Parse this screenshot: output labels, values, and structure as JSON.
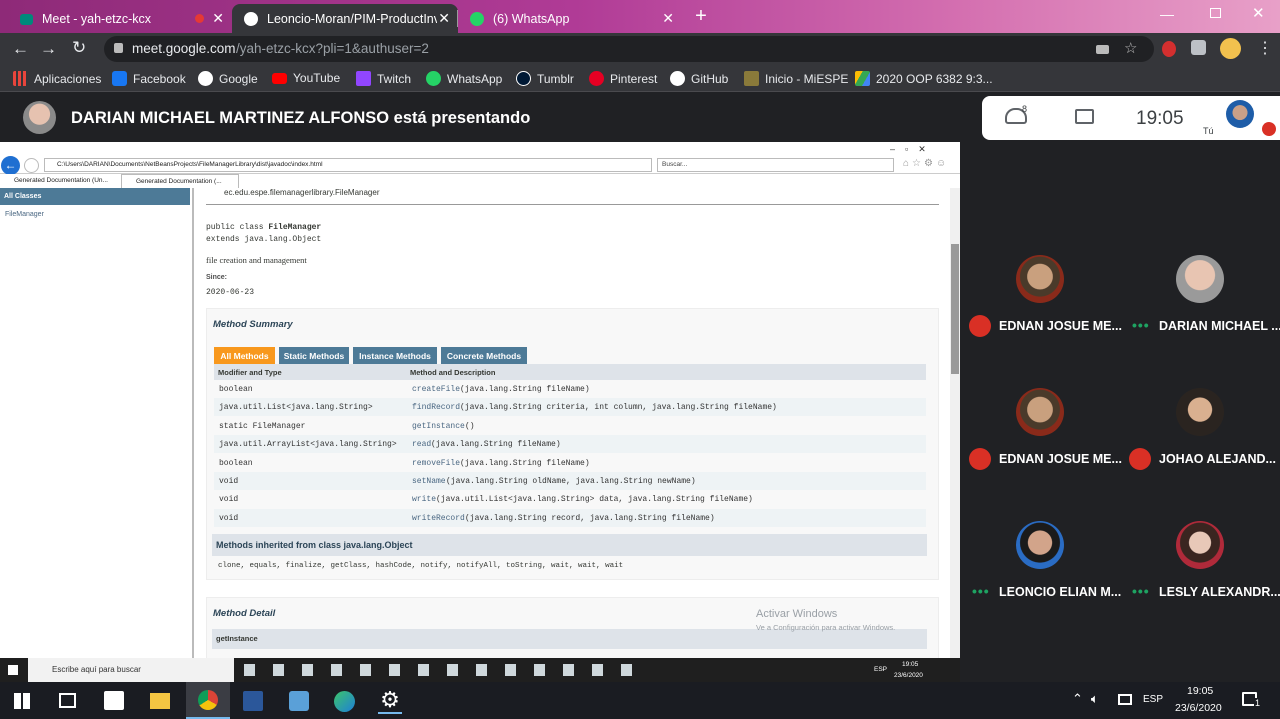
{
  "tabs": [
    {
      "title": "Meet - yah-etzc-kcx",
      "icon": "meet-icon"
    },
    {
      "title": "Leoncio-Moran/PIM-ProductInve",
      "icon": "github-icon"
    },
    {
      "title": "(6) WhatsApp",
      "icon": "whatsapp-icon"
    }
  ],
  "url": {
    "host": "meet.google.com",
    "path": "/yah-etzc-kcx?pli=1&authuser=2"
  },
  "bookmarks": [
    "Aplicaciones",
    "Facebook",
    "Google",
    "YouTube",
    "Twitch",
    "WhatsApp",
    "Tumblr",
    "Pinterest",
    "GitHub",
    "Inicio - MiESPE",
    "2020 OOP 6382 9:3..."
  ],
  "meet": {
    "presenter_text": "DARIAN MICHAEL MARTINEZ ALFONSO está presentando",
    "participant_count": "8",
    "time": "19:05",
    "self_label": "Tú",
    "participants": [
      {
        "name": "EDNAN JOSUE ME...",
        "muted": true
      },
      {
        "name": "DARIAN MICHAEL ...",
        "muted": false
      },
      {
        "name": "EDNAN JOSUE ME...",
        "muted": true
      },
      {
        "name": "JOHAO ALEJAND...",
        "muted": true
      },
      {
        "name": "LEONCIO ELIAN M...",
        "muted": false
      },
      {
        "name": "LESLY ALEXANDR...",
        "muted": false
      }
    ]
  },
  "shared": {
    "ie_path": "C:\\Users\\DARIAN\\Documents\\NetBeansProjects\\FileManagerLibrary\\dist\\javadoc\\index.html",
    "ie_search": "Buscar...",
    "ie_tabs": [
      "Generated Documentation (Un...",
      "Generated Documentation (..."
    ],
    "all_classes": "All Classes",
    "class_link": "FileManager",
    "package_line": "ec.edu.espe.filemanagerlibrary.FileManager",
    "decl1a": "public class ",
    "decl1b": "FileManager",
    "decl2": "extends java.lang.Object",
    "desc": "file creation and management",
    "since_label": "Since:",
    "since_value": "2020-06-23",
    "method_summary": "Method Summary",
    "method_tabs": [
      "All Methods",
      "Static Methods",
      "Instance Methods",
      "Concrete Methods"
    ],
    "col_modifier": "Modifier and Type",
    "col_method": "Method and Description",
    "methods": [
      {
        "type": "boolean",
        "name": "createFile",
        "args": "(java.lang.String fileName)"
      },
      {
        "type": "java.util.List<java.lang.String>",
        "name": "findRecord",
        "args": "(java.lang.String criteria, int column, java.lang.String fileName)"
      },
      {
        "type": "static FileManager",
        "name": "getInstance",
        "args": "()"
      },
      {
        "type": "java.util.ArrayList<java.lang.String>",
        "name": "read",
        "args": "(java.lang.String fileName)"
      },
      {
        "type": "boolean",
        "name": "removeFile",
        "args": "(java.lang.String fileName)"
      },
      {
        "type": "void",
        "name": "setName",
        "args": "(java.lang.String oldName, java.lang.String newName)"
      },
      {
        "type": "void",
        "name": "write",
        "args": "(java.util.List<java.lang.String> data, java.lang.String fileName)"
      },
      {
        "type": "void",
        "name": "writeRecord",
        "args": "(java.lang.String record, java.lang.String fileName)"
      }
    ],
    "inherited_title": "Methods inherited from class java.lang.Object",
    "inherited_list": "clone, equals, finalize, getClass, hashCode, notify, notifyAll, toString, wait, wait, wait",
    "method_detail": "Method Detail",
    "detail_first": "getInstance",
    "watermark1": "Activar Windows",
    "watermark2": "Ve a Configuración para activar Windows.",
    "inner_search": "Escribe aquí para buscar",
    "inner_lang": "ESP",
    "inner_time": "19:05",
    "inner_date": "23/6/2020"
  },
  "taskbar": {
    "lang": "ESP",
    "time": "19:05",
    "date": "23/6/2020",
    "notif": "1"
  }
}
